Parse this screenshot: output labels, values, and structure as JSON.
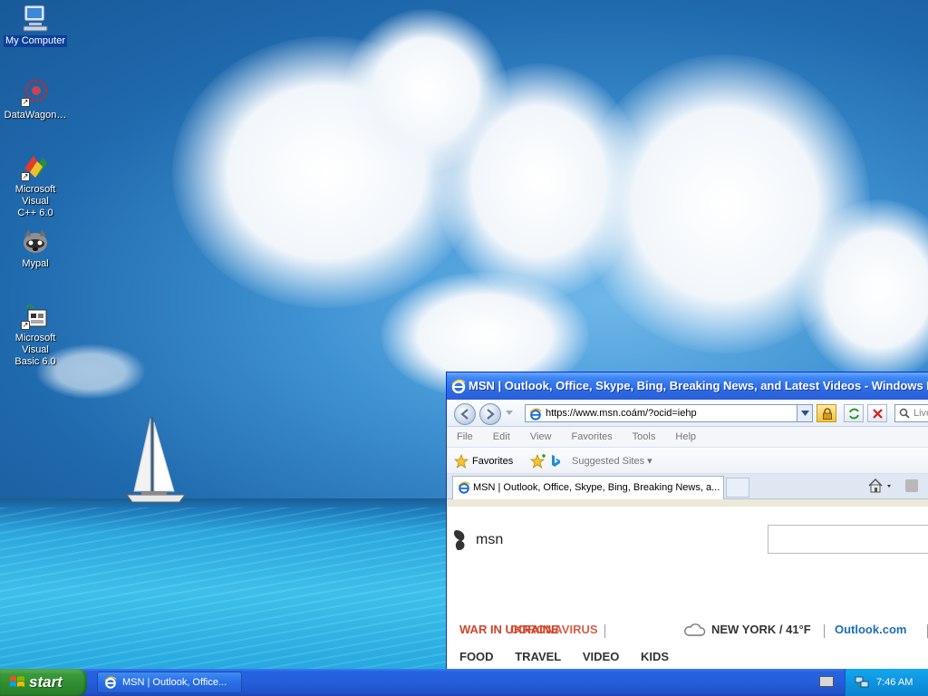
{
  "desktop": {
    "icons": [
      {
        "label": "My Computer",
        "icon": "my-computer-icon"
      },
      {
        "label": "DataWagon…",
        "icon": "datawagon-icon"
      },
      {
        "label_line1": "Microsoft Visual",
        "label_line2": "C++ 6.0",
        "icon": "visual-cpp-icon"
      },
      {
        "label": "Mypal",
        "icon": "mypal-icon"
      },
      {
        "label_line1": "Microsoft Visual",
        "label_line2": "Basic 6.0",
        "icon": "visual-basic-icon"
      }
    ]
  },
  "ie": {
    "title": "MSN | Outlook, Office, Skype, Bing, Breaking News, and Latest Videos - Windows Internet Explorer",
    "address": "https://www.msn.coám/?ocid=iehp",
    "search_placeholder": "Live",
    "menu": [
      "File",
      "Edit",
      "View",
      "Favorites",
      "Tools",
      "Help"
    ],
    "favorites_label": "Favorites",
    "suggested_sites_label": "Suggested Sites ▾",
    "tab_title": "MSN | Outlook, Office, Skype, Bing, Breaking News, a...",
    "content": {
      "logo_text": "msn",
      "breaking_a": "WAR IN UKRAINE",
      "breaking_b": "CORONAVIRUS",
      "weather": "NEW YORK / 41°F",
      "outlook_link": "Outlook.com",
      "nav": [
        "FOOD",
        "TRAVEL",
        "VIDEO",
        "KIDS"
      ]
    }
  },
  "taskbar": {
    "start_label": "start",
    "task_label": "MSN | Outlook, Office...",
    "clock": "7:46 AM"
  },
  "colors": {
    "taskbar_blue": "#245edb",
    "start_green": "#3a9a3a",
    "breaking_red": "#d2442a",
    "outlook_blue": "#1c6fb8"
  }
}
